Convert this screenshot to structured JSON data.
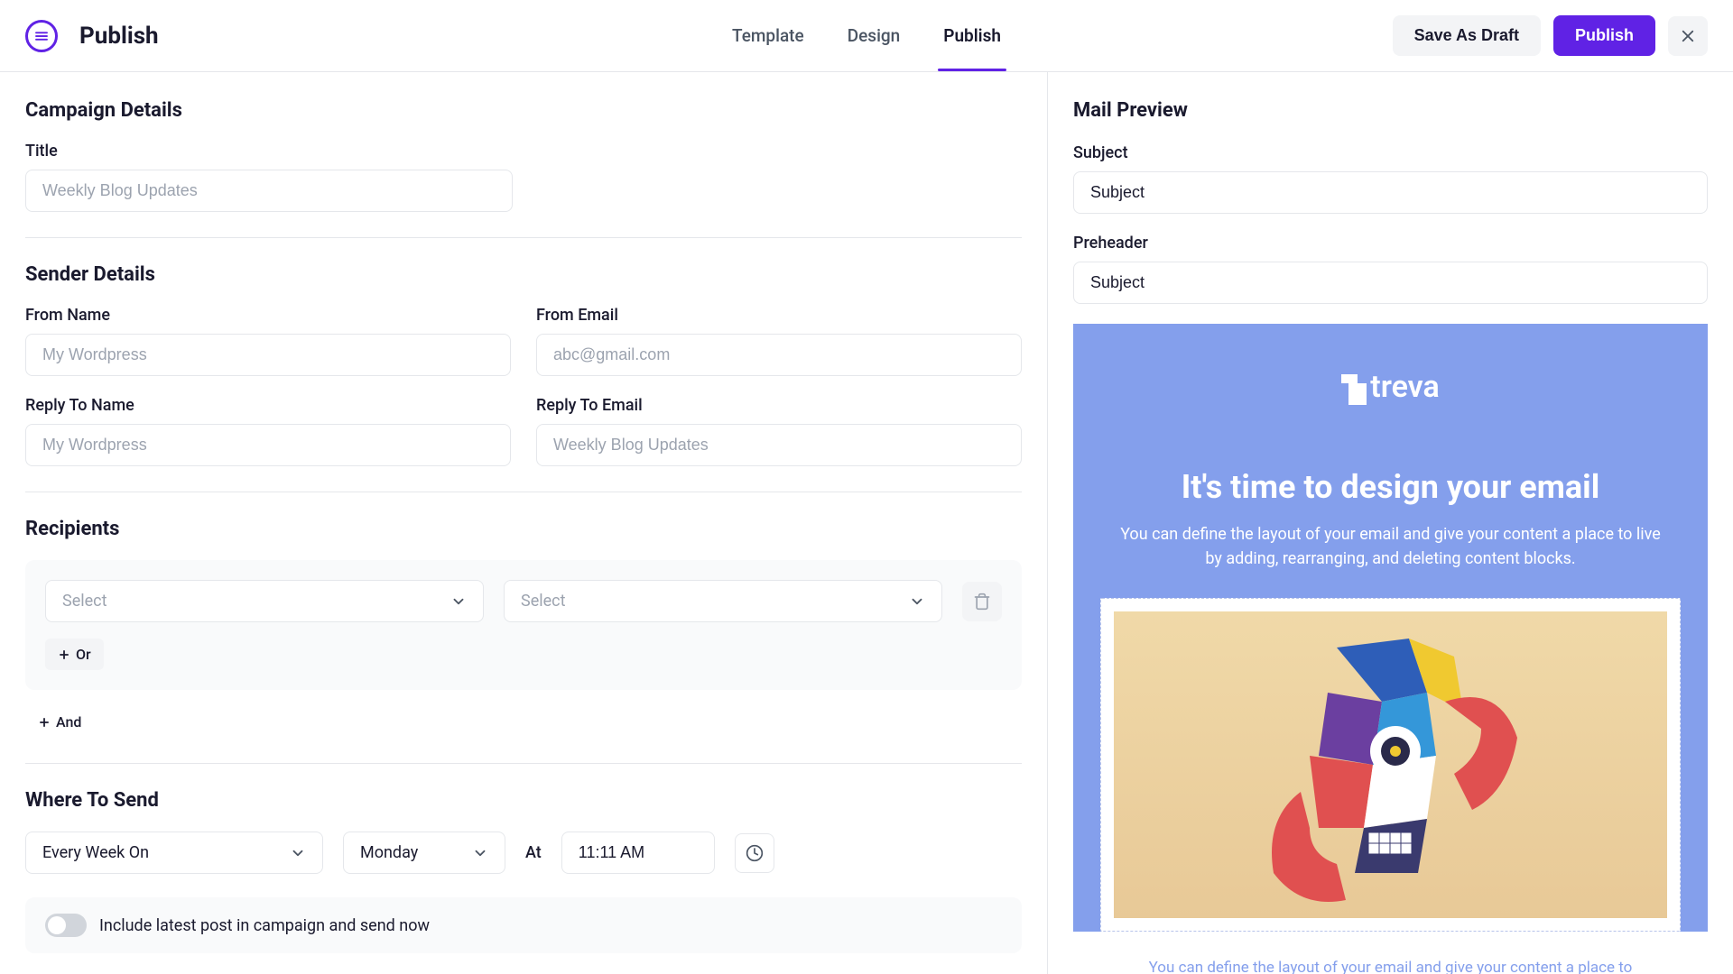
{
  "header": {
    "title": "Publish",
    "tabs": [
      {
        "label": "Template",
        "active": false
      },
      {
        "label": "Design",
        "active": false
      },
      {
        "label": "Publish",
        "active": true
      }
    ],
    "save_draft_label": "Save As Draft",
    "publish_label": "Publish"
  },
  "campaign": {
    "section_title": "Campaign Details",
    "title_label": "Title",
    "title_placeholder": "Weekly Blog Updates"
  },
  "sender": {
    "section_title": "Sender Details",
    "from_name_label": "From Name",
    "from_name_placeholder": "My Wordpress",
    "from_email_label": "From Email",
    "from_email_placeholder": "abc@gmail.com",
    "reply_name_label": "Reply To Name",
    "reply_name_placeholder": "My Wordpress",
    "reply_email_label": "Reply To Email",
    "reply_email_placeholder": "Weekly Blog Updates"
  },
  "recipients": {
    "section_title": "Recipients",
    "select_placeholder": "Select",
    "or_label": "Or",
    "and_label": "And"
  },
  "schedule": {
    "section_title": "Where To Send",
    "frequency": "Every Week On",
    "day": "Monday",
    "at_label": "At",
    "time": "11:11 AM",
    "toggle_label": "Include latest post in campaign and send now"
  },
  "preview": {
    "title": "Mail Preview",
    "subject_label": "Subject",
    "subject_value": "Subject",
    "preheader_label": "Preheader",
    "preheader_value": "Subject",
    "email": {
      "logo_text": "treva",
      "headline": "It's time to design your email",
      "sub": "You can define the layout of your email and give your content a place to live by adding, rearranging, and deleting content blocks.",
      "footer_text": "You can define the layout of your email and give your content a place to"
    }
  },
  "icons": {
    "chevron_down": "chevron-down",
    "close": "close",
    "trash": "trash",
    "plus": "plus",
    "clock": "clock",
    "menu": "menu"
  }
}
